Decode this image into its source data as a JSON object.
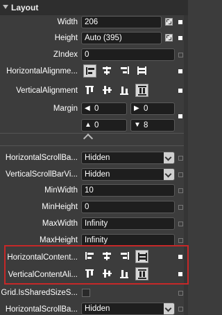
{
  "section": {
    "title": "Layout"
  },
  "rows": {
    "width": {
      "label": "Width",
      "value": "206"
    },
    "height": {
      "label": "Height",
      "value": "Auto (395)"
    },
    "zindex": {
      "label": "ZIndex",
      "value": "0"
    },
    "horizontal_alignment": {
      "label": "HorizontalAlignme..."
    },
    "vertical_alignment": {
      "label": "VerticalAlignment"
    },
    "margin": {
      "label": "Margin",
      "left": "0",
      "right": "0",
      "top": "0",
      "bottom": "8"
    },
    "horizontal_scrollbar_visibility": {
      "label": "HorizontalScrollBa...",
      "value": "Hidden"
    },
    "vertical_scrollbar_visibility": {
      "label": "VerticalScrollBarVi...",
      "value": "Hidden"
    },
    "min_width": {
      "label": "MinWidth",
      "value": "10"
    },
    "min_height": {
      "label": "MinHeight",
      "value": "0"
    },
    "max_width": {
      "label": "MaxWidth",
      "value": "Infinity"
    },
    "max_height": {
      "label": "MaxHeight",
      "value": "Infinity"
    },
    "horizontal_content_alignment": {
      "label": "HorizontalContent..."
    },
    "vertical_content_alignment": {
      "label": "VerticalContentAli..."
    },
    "grid_is_shared_size_scope": {
      "label": "Grid.IsSharedSizeS..."
    },
    "horizontal_scrollbar_visibility_2": {
      "label": "HorizontalScrollBa...",
      "value": "Hidden"
    }
  },
  "icons": {
    "margin_left": "arrow-left-icon",
    "margin_right": "arrow-right-icon",
    "margin_top": "arrow-up-icon",
    "margin_bottom": "arrow-down-icon"
  },
  "colors": {
    "highlight_border": "#c62828",
    "panel_bg": "#3c3c3c"
  }
}
